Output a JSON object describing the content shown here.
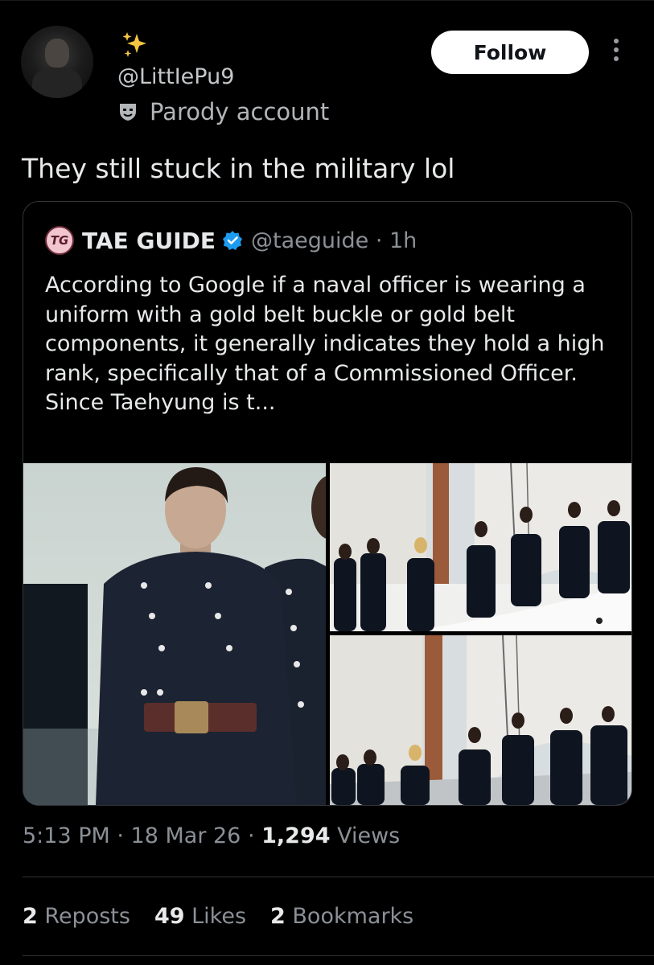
{
  "author": {
    "handle": "@LittIePu9",
    "label": "Parody account",
    "emoji_icon": "sparkles-icon"
  },
  "follow_label": "Follow",
  "tweet_text": "They still stuck in the military lol",
  "quoted": {
    "logo_text": "TG",
    "name": "TAE GUIDE",
    "handle_time": "@taeguide · 1h",
    "text": "According to Google if a naval officer is wearing a uniform with a gold belt buckle or gold belt components, it generally indicates they hold a high rank, specifically that of a Commissioned Officer. Since Taehyung is t..."
  },
  "meta": {
    "time_date": "5:13 PM · 18 Mar 26 · ",
    "views_count": "1,294",
    "views_label": " Views"
  },
  "stats": {
    "reposts_count": "2",
    "reposts_label": "Reposts",
    "likes_count": "49",
    "likes_label": "Likes",
    "bookmarks_count": "2",
    "bookmarks_label": "Bookmarks"
  },
  "colors": {
    "background": "#000000",
    "text": "#e7e9ea",
    "secondary": "#8b9096",
    "verified": "#1d9bf0"
  }
}
